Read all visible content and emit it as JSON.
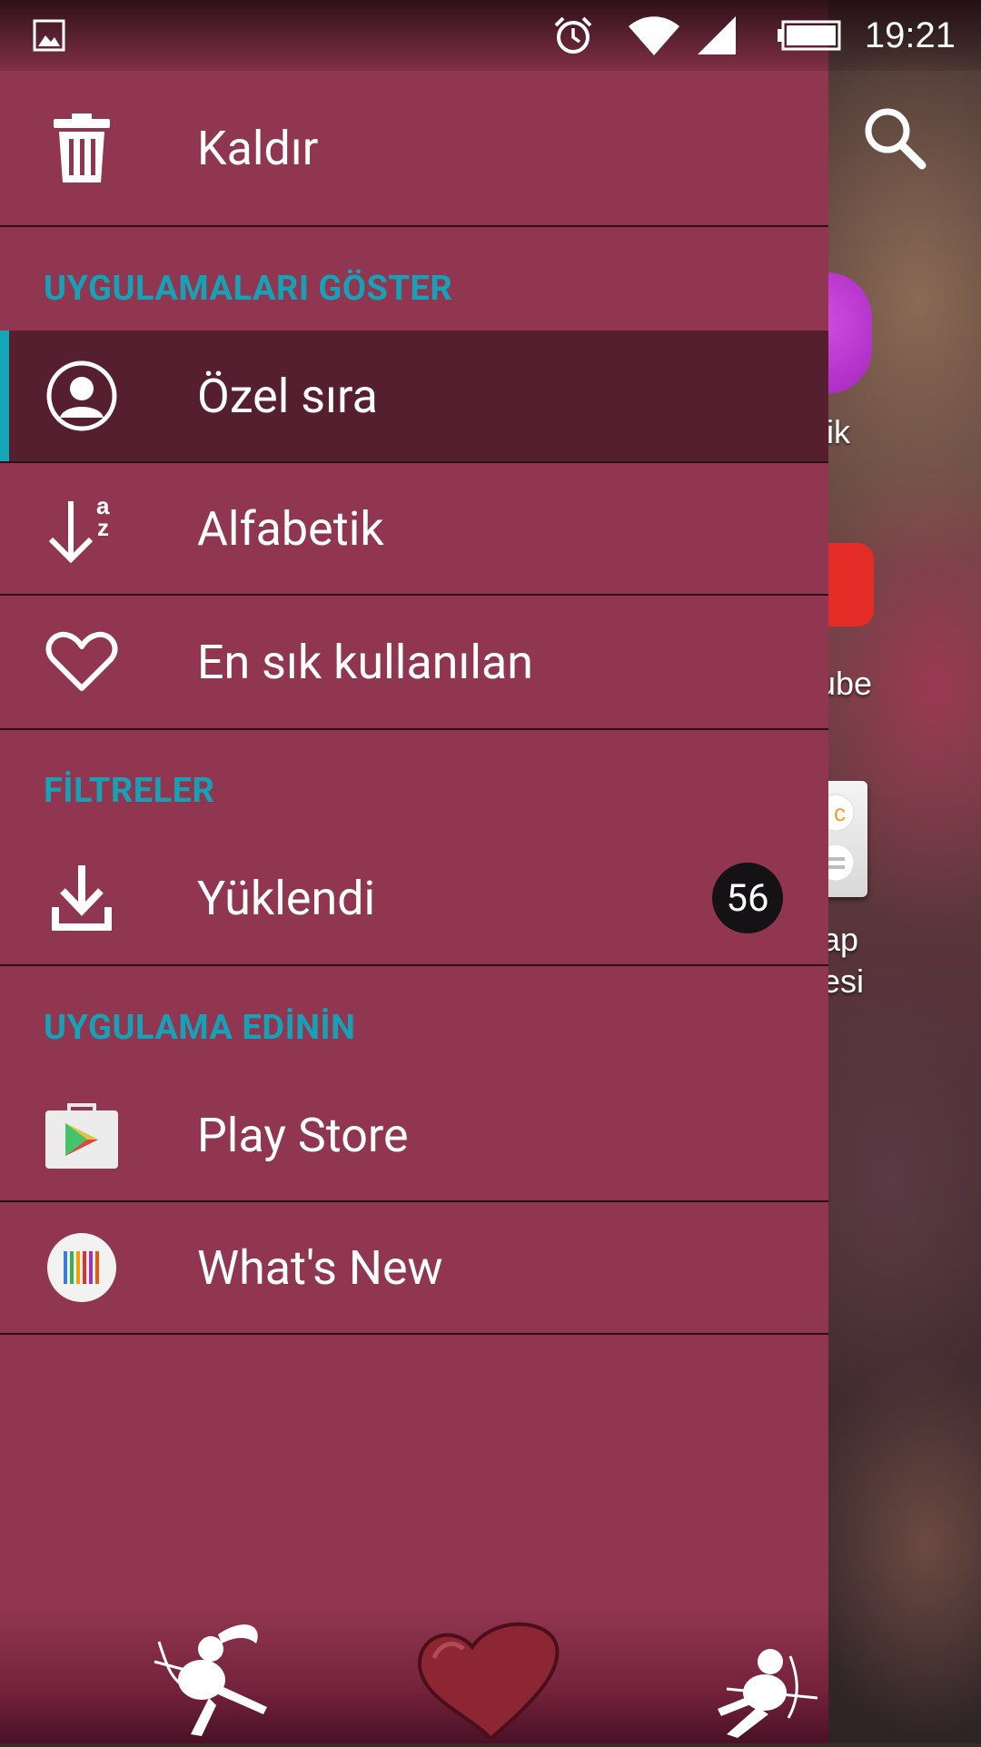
{
  "status_bar": {
    "time": "19:21",
    "icons": [
      "image-icon",
      "alarm-icon",
      "wifi-icon",
      "signal-icon",
      "battery-icon"
    ]
  },
  "drawer": {
    "uninstall_label": "Kaldır",
    "sections": {
      "show_apps": "UYGULAMALARI GÖSTER",
      "filters": "FİLTRELER",
      "get_apps": "UYGULAMA EDİNİN"
    },
    "sort_items": [
      {
        "label": "Özel sıra",
        "icon": "user-circle-icon",
        "selected": true
      },
      {
        "label": "Alfabetik",
        "icon": "sort-alpha-icon",
        "selected": false
      },
      {
        "label": "En sık kullanılan",
        "icon": "heart-outline-icon",
        "selected": false
      }
    ],
    "filter_items": [
      {
        "label": "Yüklendi",
        "icon": "download-icon",
        "count": "56"
      }
    ],
    "get_items": [
      {
        "label": "Play Store",
        "icon": "play-store-icon"
      },
      {
        "label": "What's New",
        "icon": "whats-new-icon"
      }
    ]
  },
  "background_apps": {
    "labels": [
      "ik",
      "ube",
      "ap",
      "esi"
    ]
  },
  "colors": {
    "drawer_bg": "#913650",
    "selected_bg": "#561f30",
    "accent": "#15a6b8",
    "section_header": "#16a1b6"
  }
}
